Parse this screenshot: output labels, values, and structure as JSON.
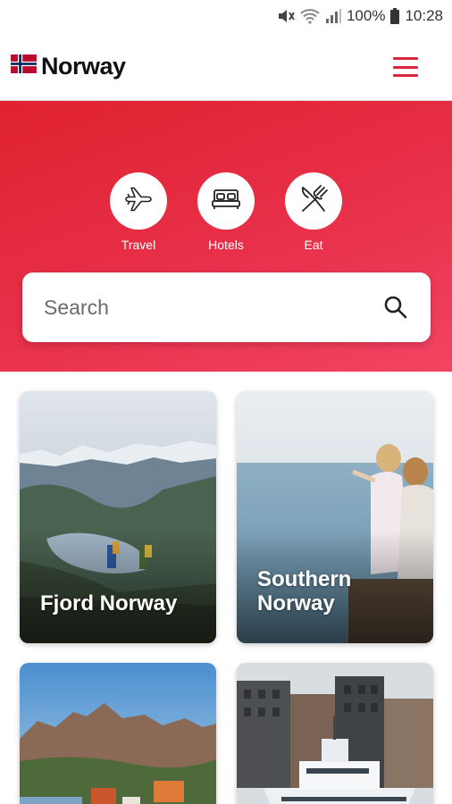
{
  "status_bar": {
    "battery": "100%",
    "time": "10:28",
    "icons": [
      "mute-icon",
      "wifi-icon",
      "signal-icon",
      "battery-icon"
    ]
  },
  "header": {
    "title": "Norway",
    "logo": "norway-flag-icon",
    "menu_icon": "hamburger-menu-icon"
  },
  "quick_links": [
    {
      "label": "Travel",
      "icon": "airplane-icon"
    },
    {
      "label": "Hotels",
      "icon": "bed-icon"
    },
    {
      "label": "Eat",
      "icon": "fork-knife-icon"
    }
  ],
  "search": {
    "placeholder": "Search",
    "icon": "search-icon"
  },
  "cards": [
    {
      "title": "Fjord Norway",
      "image": "fjord-hikers-photo"
    },
    {
      "title": "Southern\nNorway",
      "image": "women-at-sea-photo"
    },
    {
      "title": "",
      "image": "mountain-village-photo"
    },
    {
      "title": "",
      "image": "harbor-ferry-photo"
    }
  ],
  "colors": {
    "accent": "#d9253a",
    "hero_start": "#e0222e",
    "hero_end": "#f24462"
  }
}
